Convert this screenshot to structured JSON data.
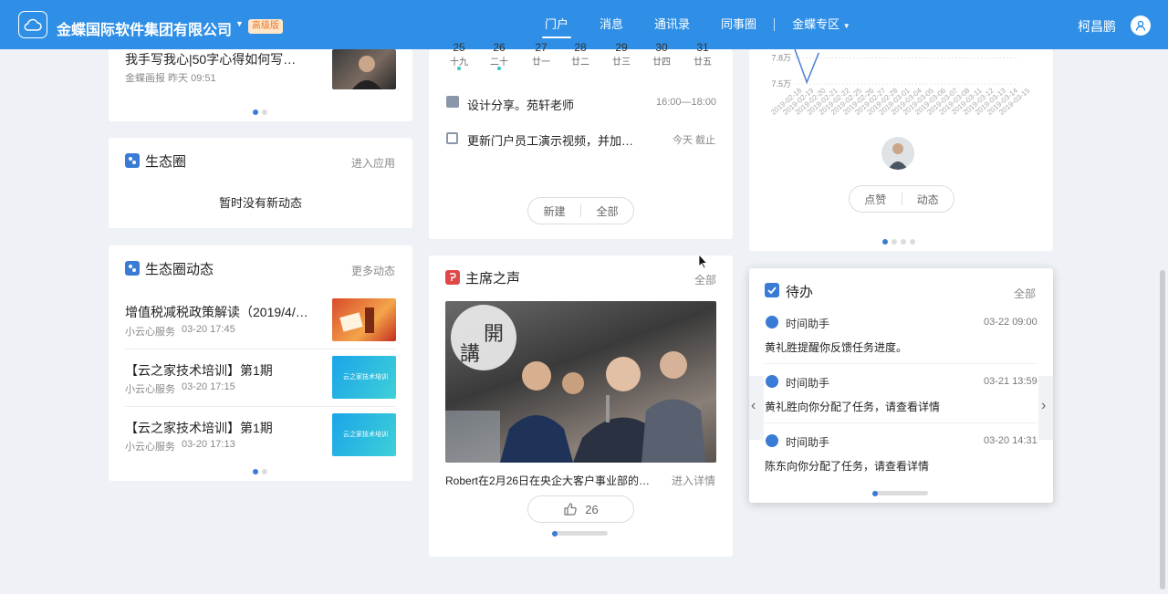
{
  "topbar": {
    "company": "金蝶国际软件集团有限公司",
    "edition": "高级版",
    "nav": [
      "门户",
      "消息",
      "通讯录",
      "同事圈"
    ],
    "nav_zone": "金蝶专区",
    "username": "柯昌鹏"
  },
  "top_left": {
    "title": "我手写我心|50字心得如何写…",
    "meta": "金蝶画报  昨天 09:51"
  },
  "eco": {
    "title": "生态圈",
    "link": "进入应用",
    "empty": "暂时没有新动态"
  },
  "eco_feed": {
    "title": "生态圈动态",
    "link": "更多动态",
    "items": [
      {
        "title": "增值税减税政策解读（2019/4/…",
        "source": "小云心服务",
        "time": "03-20 17:45"
      },
      {
        "title": "【云之家技术培训】第1期",
        "source": "小云心服务",
        "time": "03-20 17:15"
      },
      {
        "title": "【云之家技术培训】第1期",
        "source": "小云心服务",
        "time": "03-20 17:13"
      }
    ],
    "thumb_text": "云之家技术培训"
  },
  "calendar": {
    "days": [
      {
        "num": "25",
        "lunar": "十九",
        "dot": true
      },
      {
        "num": "26",
        "lunar": "二十",
        "dot": true
      },
      {
        "num": "27",
        "lunar": "廿一",
        "dot": false
      },
      {
        "num": "28",
        "lunar": "廿二",
        "dot": false
      },
      {
        "num": "29",
        "lunar": "廿三",
        "dot": false
      },
      {
        "num": "30",
        "lunar": "廿四",
        "dot": false
      },
      {
        "num": "31",
        "lunar": "廿五",
        "dot": false
      }
    ],
    "events": [
      {
        "title": "设计分享。苑轩老师",
        "time": "16:00—18:00"
      },
      {
        "title": "更新门户员工演示视频，并加…",
        "time": "今天 截止"
      }
    ],
    "btn_new": "新建",
    "btn_all": "全部"
  },
  "chairman": {
    "title": "主席之声",
    "link": "全部",
    "caption": "Robert在2月26日在央企大客户事业部的…",
    "detail": "进入详情",
    "likes": "26",
    "image_sign_1": "開",
    "image_sign_2": "講"
  },
  "chart_data": {
    "type": "line",
    "title": "",
    "xlabel": "",
    "ylabel": "",
    "yticks": [
      "7.8万",
      "7.5万"
    ],
    "x": [
      "2019-02-18",
      "2019-02-19",
      "2019-02-20",
      "2019-02-21",
      "2019-02-22",
      "2019-02-25",
      "2019-02-26",
      "2019-02-27",
      "2019-02-28",
      "2019-03-01",
      "2019-03-04",
      "2019-03-05",
      "2019-03-06",
      "2019-03-07",
      "2019-03-08",
      "2019-03-11",
      "2019-03-12",
      "2019-03-13",
      "2019-03-14",
      "2019-03-15"
    ],
    "series": [
      {
        "values": [
          79000,
          75200,
          78600
        ]
      }
    ],
    "ylim": [
      74800,
      79000
    ]
  },
  "stock": {
    "like": "点赞",
    "feed": "动态"
  },
  "todo": {
    "title": "待办",
    "link": "全部",
    "items": [
      {
        "who": "时间助手",
        "time": "03-22 09:00",
        "text": "黄礼胜提醒你反馈任务进度。"
      },
      {
        "who": "时间助手",
        "time": "03-21 13:59",
        "text": "黄礼胜向你分配了任务，请查看详情"
      },
      {
        "who": "时间助手",
        "time": "03-20 14:31",
        "text": "陈东向你分配了任务，请查看详情"
      }
    ]
  },
  "colors": {
    "brand": "#2f8fe6",
    "accent": "#3a7bd5",
    "calendar_dot": "#39c3c3",
    "chairman_icon": "#e04848"
  }
}
